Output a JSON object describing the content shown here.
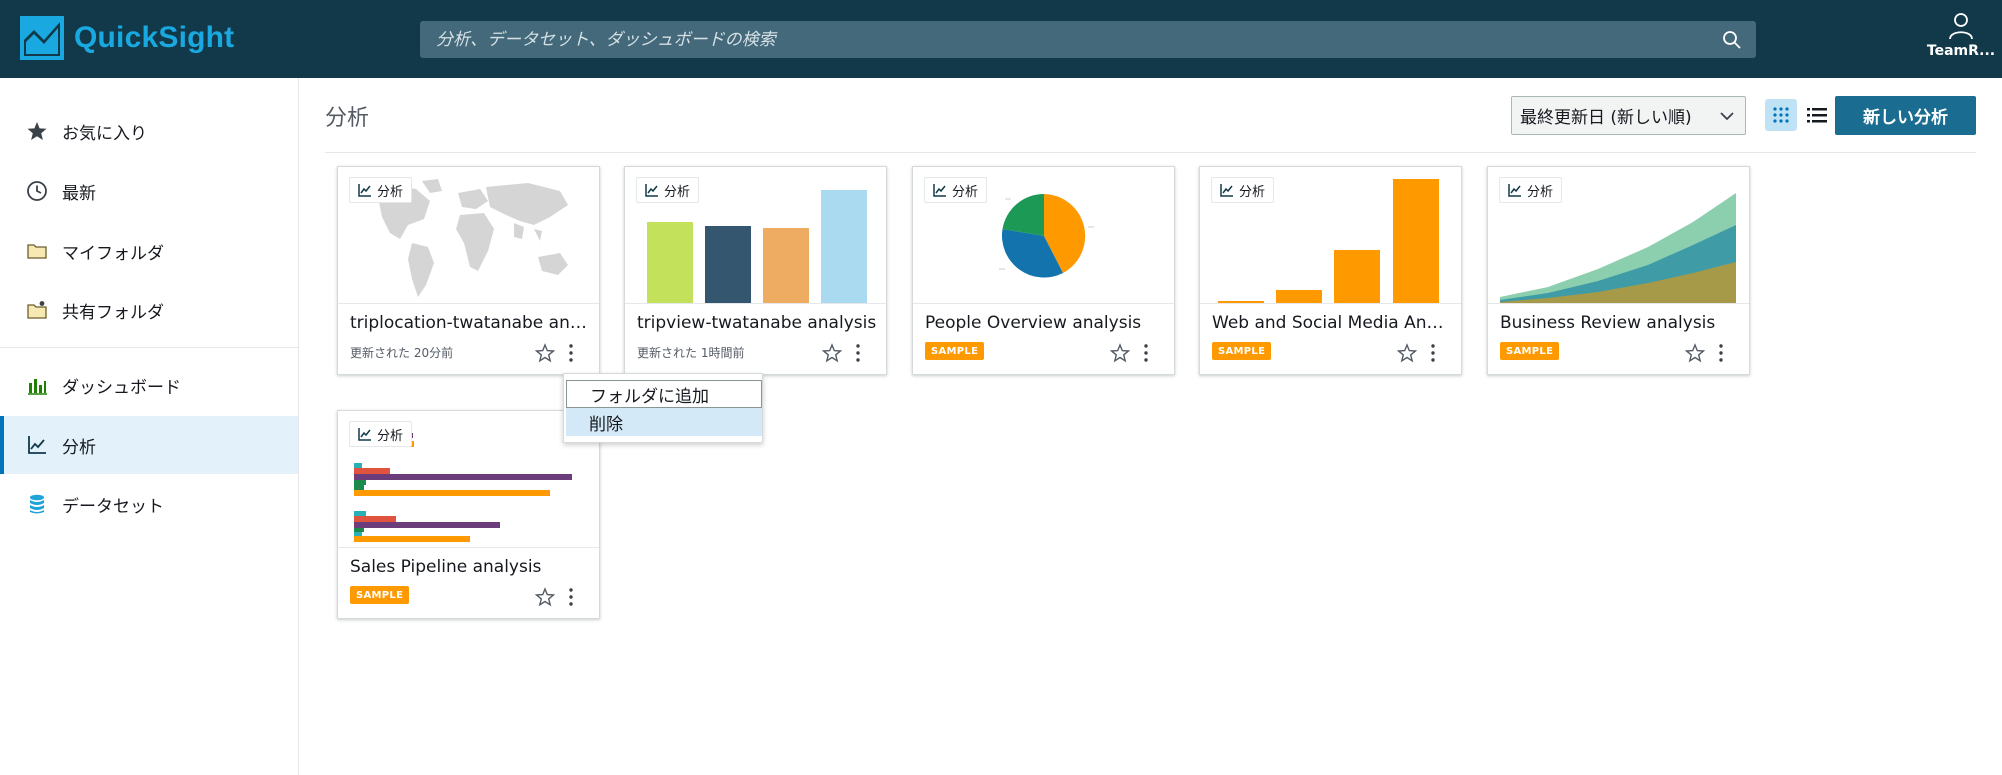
{
  "app": {
    "name": "QuickSight",
    "user": "TeamR..."
  },
  "search": {
    "placeholder": "分析、データセット、ダッシュボードの検索"
  },
  "sidebar": {
    "items": [
      {
        "label": "お気に入り",
        "icon": "star-icon"
      },
      {
        "label": "最新",
        "icon": "clock-icon"
      },
      {
        "label": "マイフォルダ",
        "icon": "folder-icon"
      },
      {
        "label": "共有フォルダ",
        "icon": "shared-folder-icon"
      },
      {
        "label": "ダッシュボード",
        "icon": "dashboard-icon"
      },
      {
        "label": "分析",
        "icon": "analysis-icon",
        "active": true
      },
      {
        "label": "データセット",
        "icon": "dataset-icon"
      }
    ]
  },
  "main": {
    "title": "分析",
    "sort": "最終更新日 (新しい順)",
    "new_button": "新しい分析"
  },
  "card_type_label": "分析",
  "sample_label": "SAMPLE",
  "cards": [
    {
      "title": "triplocation-twatanabe analysis",
      "meta": "更新された 20分前",
      "thumb": "map"
    },
    {
      "title": "tripview-twatanabe analysis",
      "meta": "更新された 1時間前",
      "thumb": "bars"
    },
    {
      "title": "People Overview analysis",
      "sample": true,
      "thumb": "pie"
    },
    {
      "title": "Web and Social Media Analysis",
      "sample": true,
      "thumb": "orange-bars"
    },
    {
      "title": "Business Review analysis",
      "sample": true,
      "thumb": "area"
    },
    {
      "title": "Sales Pipeline analysis",
      "sample": true,
      "thumb": "hbars"
    }
  ],
  "context_menu": {
    "items": [
      "フォルダに追加",
      "削除"
    ]
  },
  "colors": {
    "topbar": "#12394a",
    "search_bg": "#43697a",
    "brand": "#19a8e0",
    "primary_button": "#1a6d91",
    "sample": "#ff9900",
    "active_nav": "#e3f1fb"
  }
}
